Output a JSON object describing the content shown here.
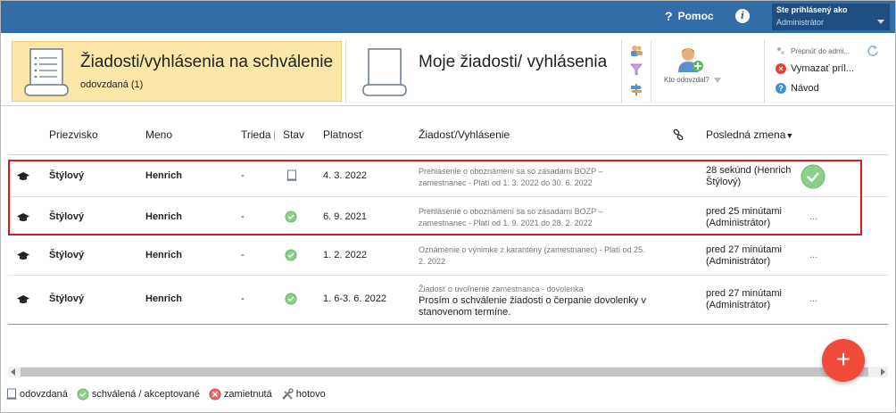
{
  "topbar": {
    "help_label": "Pomoc",
    "info_icon": "info-icon",
    "user_label": "Ste prihlásený ako",
    "user_name": "Administrátor"
  },
  "ribbon": {
    "active_card": {
      "title": "Žiadosti/vyhlásenia na schválenie",
      "subtitle": "odovzdaná (1)"
    },
    "second_card": {
      "title": "Moje žiadosti/ vyhlásenia"
    },
    "kto_label": "Kto odovzdal?",
    "actions": [
      {
        "label": "Prepnúť do admi...",
        "icon": "switch-icon"
      },
      {
        "label": "Vymazať príl...",
        "icon": "delete-icon",
        "color": "#e0433a"
      },
      {
        "label": "Návod",
        "icon": "help-icon",
        "color": "#3d8fd6"
      }
    ]
  },
  "table": {
    "headers": {
      "priezvisko": "Priezvisko",
      "meno": "Meno",
      "trieda": "Trieda",
      "stav": "Stav",
      "platnost": "Platnosť",
      "ziadost": "Žiadosť/Vyhlásenie",
      "posledna": "Posledná zmena"
    },
    "rows": [
      {
        "priezvisko": "Štýlový",
        "meno": "Henrich",
        "trieda": "-",
        "stav": "odovzdaná",
        "platnost": "4. 3. 2022",
        "desc": "Prehlásenie o oboznámení sa so zásadami BOZP – zamestnanec - Platí od 1. 3. 2022 do 30. 6. 2022",
        "desc_main": "",
        "zmena": "28 sekúnd (Henrich Štýlový)",
        "more": ""
      },
      {
        "priezvisko": "Štýlový",
        "meno": "Henrich",
        "trieda": "-",
        "stav": "schválená",
        "platnost": "6. 9. 2021",
        "desc": "Prehlásenie o oboznámení sa so zásadami BOZP – zamestnanec - Platí od 1. 9. 2021 do 28. 2. 2022",
        "desc_main": "",
        "zmena": "pred 25 minútami (Administrátor)",
        "more": "..."
      },
      {
        "priezvisko": "Štýlový",
        "meno": "Henrich",
        "trieda": "-",
        "stav": "schválená",
        "platnost": "1. 2. 2022",
        "desc": "Oznámenie o výnimke z karantény (zamestnanec) - Platí od 25. 2. 2022",
        "desc_main": "",
        "zmena": "pred 27 minútami (Administrátor)",
        "more": "..."
      },
      {
        "priezvisko": "Štýlový",
        "meno": "Henrich",
        "trieda": "-",
        "stav": "schválená",
        "platnost": "1. 6-3. 6. 2022",
        "desc": "Žiadosť o uvoľnenie zamestnanca - dovolenka",
        "desc_main": "Prosím o schválenie žiadosti o čerpanie dovolenky v stanovenom termíne.",
        "zmena": "pred 27 minútami (Administrátor)",
        "more": "..."
      }
    ]
  },
  "fab": {
    "label": "+"
  },
  "legend": [
    {
      "label": "odovzdaná",
      "icon": "document-icon"
    },
    {
      "label": "schválená / akceptované",
      "icon": "check-circle-icon"
    },
    {
      "label": "zamietnutá",
      "icon": "reject-icon"
    },
    {
      "label": "hotovo",
      "icon": "tools-icon"
    }
  ],
  "colors": {
    "topbar": "#336da8",
    "active_card": "#fbe7a8",
    "highlight": "#d8191f",
    "fab": "#f04a3a",
    "approve": "#5cb85c"
  }
}
